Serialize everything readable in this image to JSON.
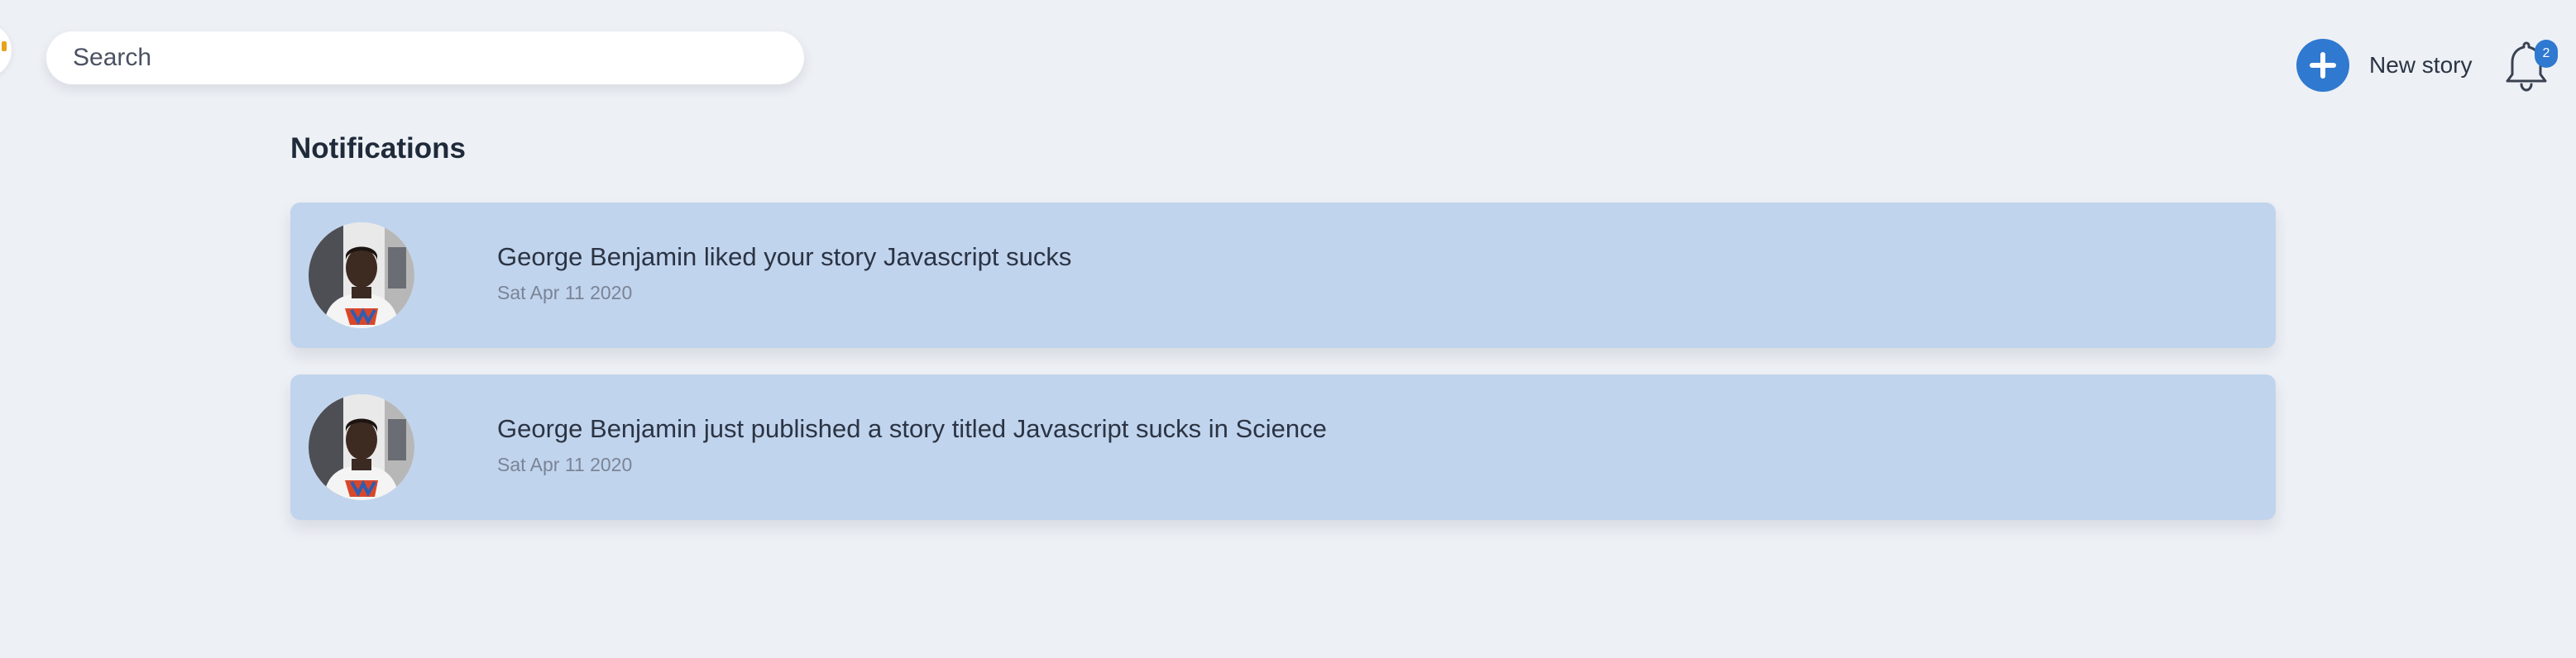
{
  "header": {
    "search": {
      "placeholder": "Search",
      "value": ""
    },
    "new_story": {
      "label": "New story",
      "icon": "plus-icon"
    },
    "notifications_bell": {
      "icon": "bell-icon",
      "badge_count": "2"
    }
  },
  "main": {
    "title": "Notifications",
    "notifications": [
      {
        "text": "George Benjamin liked your story Javascript sucks",
        "date": "Sat Apr 11 2020",
        "avatar": "user-avatar"
      },
      {
        "text": "George Benjamin just published a story titled Javascript sucks in Science",
        "date": "Sat Apr 11 2020",
        "avatar": "user-avatar"
      }
    ]
  },
  "colors": {
    "background": "#edf0f5",
    "accent": "#2f79d0",
    "notification_bg": "#c1d4ed",
    "text": "#2b3444",
    "muted_text": "#7a8496"
  }
}
